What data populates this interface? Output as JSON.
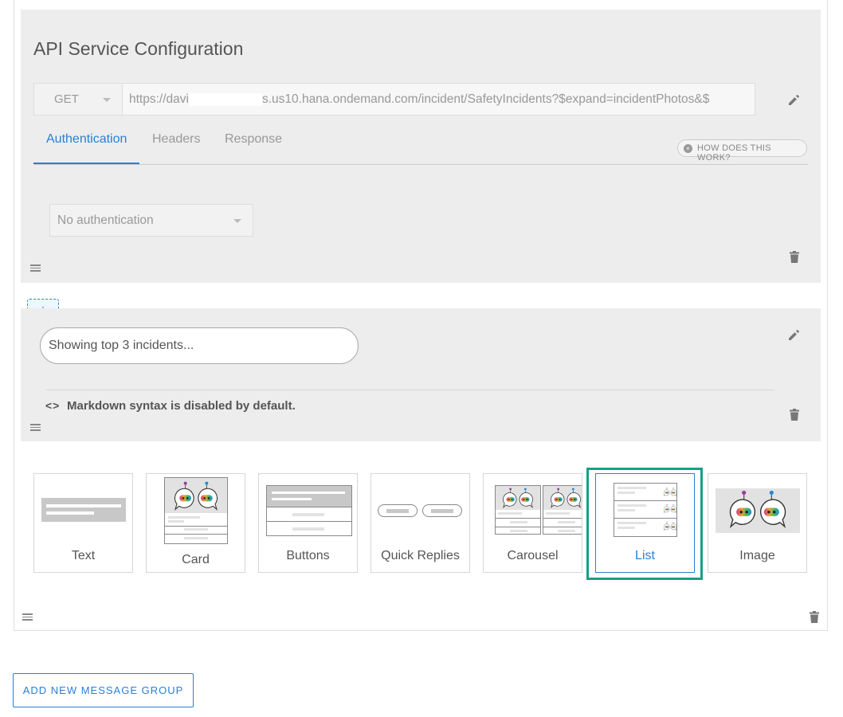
{
  "api_config": {
    "title": "API Service Configuration",
    "method": "GET",
    "url_prefix": "https://davi",
    "url_suffix": "s.us10.hana.ondemand.com/incident/SafetyIncidents?$expand=incidentPhotos&$",
    "tabs": [
      {
        "label": "Authentication",
        "active": true
      },
      {
        "label": "Headers",
        "active": false
      },
      {
        "label": "Response",
        "active": false
      }
    ],
    "help_label": "HOW DOES THIS WORK?",
    "auth_value": "No authentication"
  },
  "add_button": {
    "label": "+"
  },
  "text_message": {
    "bubble_text": "Showing top 3 incidents...",
    "md_icon": "<>",
    "markdown_note": "Markdown syntax is disabled by default."
  },
  "message_types": [
    {
      "label": "Text"
    },
    {
      "label": "Card"
    },
    {
      "label": "Buttons"
    },
    {
      "label": "Quick Replies"
    },
    {
      "label": "Carousel"
    },
    {
      "label": "List",
      "selected": true
    },
    {
      "label": "Image"
    }
  ],
  "footer": {
    "add_group_label": "ADD NEW MESSAGE GROUP"
  },
  "colors": {
    "accent": "#2a7fd4",
    "highlight": "#16a085",
    "panel_bg": "#ededed"
  },
  "icons": [
    "pencil-icon",
    "trash-icon",
    "drag-handle-icon",
    "caret-down-icon",
    "help-icon",
    "code-icon",
    "robot-icon"
  ]
}
